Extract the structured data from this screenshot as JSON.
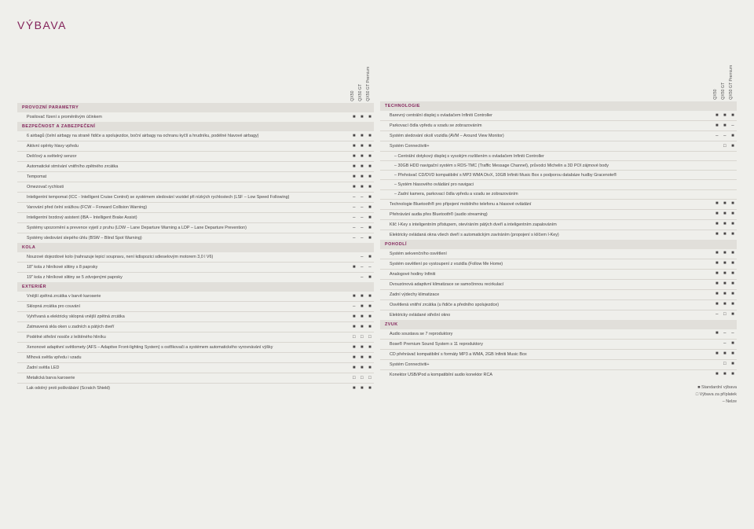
{
  "title": "VÝBAVA",
  "columnHeaders": [
    "QX50",
    "QX50 GT",
    "QX50 GT Premium"
  ],
  "legend": [
    "■ Standardní výbava",
    "□ Výbava za příplatek",
    "– Nelze"
  ],
  "symbols": {
    "f": "■",
    "o": "□",
    "n": "–",
    "b": ""
  },
  "left": [
    {
      "type": "section",
      "text": "PROVOZNÍ PARAMETRY"
    },
    {
      "type": "row",
      "text": "Posilovač řízení s proměnlivým účinkem",
      "v": [
        "f",
        "f",
        "f"
      ]
    },
    {
      "type": "section",
      "text": "BEZPEČNOST A ZABEZPEČENÍ"
    },
    {
      "type": "row",
      "text": "6 airbagů (čelní airbagy na straně řidiče a spolujezdce, boční airbagy na ochranu kyčlí a hrudníku, podélné hlavové airbagy)",
      "v": [
        "f",
        "f",
        "f"
      ]
    },
    {
      "type": "row",
      "text": "Aktivní opěrky hlavy vpředu",
      "v": [
        "f",
        "f",
        "f"
      ]
    },
    {
      "type": "row",
      "text": "Dešťový a světelný senzor",
      "v": [
        "f",
        "f",
        "f"
      ]
    },
    {
      "type": "row",
      "text": "Automatické stmívání vnitřního zpětného zrcátka",
      "v": [
        "f",
        "f",
        "f"
      ]
    },
    {
      "type": "row",
      "text": "Tempomat",
      "v": [
        "f",
        "f",
        "f"
      ]
    },
    {
      "type": "row",
      "text": "Omezovač rychlosti",
      "v": [
        "f",
        "f",
        "f"
      ]
    },
    {
      "type": "row",
      "text": "Inteligentní tempomat (ICC - Intelligent Cruise Control) se systémem sledování vozidel při nízkých rychlostech (LSF – Low Speed Following)",
      "v": [
        "n",
        "n",
        "f"
      ]
    },
    {
      "type": "row",
      "text": "Varování před čelní srážkou (FCW – Forward Collision Warning)",
      "v": [
        "n",
        "n",
        "f"
      ]
    },
    {
      "type": "row",
      "text": "Inteligentní brzdový asistent (IBA – Intelligent Brake Assist)",
      "v": [
        "n",
        "n",
        "f"
      ]
    },
    {
      "type": "row",
      "text": "Systémy upozornění a prevence vyjetí z pruhu (LDW – Lane Departure Warning a LDP – Lane Departure Prevention)",
      "v": [
        "n",
        "n",
        "f"
      ]
    },
    {
      "type": "row",
      "text": "Systémy sledování slepého úhlu (BSW – Blind Spot Warning)",
      "v": [
        "n",
        "n",
        "f"
      ]
    },
    {
      "type": "section",
      "text": "KOLA"
    },
    {
      "type": "row",
      "text": "Nouzové dojezdové kolo (nahrazuje lepicí soupravu, není kdispozici sdieselovým motorem 3,0 l V6)",
      "v": [
        "b",
        "n",
        "f"
      ]
    },
    {
      "type": "row",
      "text": "18\" kola z hliníkové slitiny s 8 paprsky",
      "v": [
        "f",
        "n",
        "n"
      ]
    },
    {
      "type": "row",
      "text": "19\" kola z hliníkové slitiny se 5 zdvojenými paprsky",
      "v": [
        "b",
        "n",
        "f"
      ]
    },
    {
      "type": "section",
      "text": "EXTERIÉR"
    },
    {
      "type": "row",
      "text": "Vnější zpětná zrcátka v barvě karoserie",
      "v": [
        "f",
        "f",
        "f"
      ]
    },
    {
      "type": "row",
      "text": "Sklopná zrcátka pro couvání",
      "v": [
        "n",
        "f",
        "f"
      ]
    },
    {
      "type": "row",
      "text": "Vyhřívaná a elektricky sklopná vnější zpětná zrcátka",
      "v": [
        "f",
        "f",
        "f"
      ]
    },
    {
      "type": "row",
      "text": "Zatmavená skla oken u zadních a pátých dveří",
      "v": [
        "f",
        "f",
        "f"
      ]
    },
    {
      "type": "row",
      "text": "Podélné střešní nosiče z leštěného hliníku",
      "v": [
        "o",
        "o",
        "o"
      ]
    },
    {
      "type": "row",
      "text": "Xenonové adaptivní světlomety (AFS – Adaptive Front-lighting System) s ostřikovači a systémem automatického vyrovnávání výšky",
      "v": [
        "f",
        "f",
        "f"
      ]
    },
    {
      "type": "row",
      "text": "Mlhová světla vpředu i vzadu",
      "v": [
        "f",
        "f",
        "f"
      ]
    },
    {
      "type": "row",
      "text": "Zadní světla LED",
      "v": [
        "f",
        "f",
        "f"
      ]
    },
    {
      "type": "row",
      "text": "Metalická barva karoserie",
      "v": [
        "o",
        "o",
        "o"
      ]
    },
    {
      "type": "row",
      "text": "Lak odolný proti poškrábání (Scratch Shield)",
      "v": [
        "f",
        "f",
        "f"
      ]
    }
  ],
  "right": [
    {
      "type": "section",
      "text": "TECHNOLOGIE"
    },
    {
      "type": "row",
      "text": "Barevný centrální displej s ovladačem Infiniti Controller",
      "v": [
        "f",
        "f",
        "f"
      ]
    },
    {
      "type": "row",
      "text": "Parkovací čidla vpředu a vzadu se zobrazováním",
      "v": [
        "f",
        "f",
        "n"
      ]
    },
    {
      "type": "row",
      "text": "Systém sledování okolí vozidla (AVM – Around View Monitor)",
      "v": [
        "n",
        "n",
        "f"
      ]
    },
    {
      "type": "row",
      "text": "Systém Connectiviti+",
      "v": [
        "b",
        "o",
        "f"
      ]
    },
    {
      "type": "sub",
      "text": "Centrální dotykový displej s vysokým rozlišením s ovladačem Infiniti Controller",
      "v": [
        "b",
        "b",
        "b"
      ]
    },
    {
      "type": "sub",
      "text": "30GB HDD navigační systém s RDS-TMC (Traffic Message Channel), průvodci Michelin a 3D POI zájmové body",
      "v": [
        "b",
        "b",
        "b"
      ]
    },
    {
      "type": "sub",
      "text": "Přehrávač CD/DVD kompatibilní s MP3 WMA DivX, 10GB Infiniti Music Box s podporou databáze hudby Gracenote®",
      "v": [
        "b",
        "b",
        "b"
      ]
    },
    {
      "type": "sub",
      "text": "Systém hlasového ovládání pro navigaci",
      "v": [
        "b",
        "b",
        "b"
      ]
    },
    {
      "type": "sub",
      "text": "Zadní kamera, parkovací čidla vpředu a vzadu se zobrazováním",
      "v": [
        "b",
        "b",
        "b"
      ]
    },
    {
      "type": "row",
      "text": "Technologie Bluetooth® pro připojení mobilního telefonu a hlasové ovládání",
      "v": [
        "f",
        "f",
        "f"
      ]
    },
    {
      "type": "row",
      "text": "Přehrávání audia přes Bluetooth® (audio streaming)",
      "v": [
        "f",
        "f",
        "f"
      ]
    },
    {
      "type": "row",
      "text": "Klíč I-Key s inteligentním přístupem, otevíráním pátých dveří a inteligentním zapalováním",
      "v": [
        "f",
        "f",
        "f"
      ]
    },
    {
      "type": "row",
      "text": "Elektricky ovládaná okna všech dveří s automatickým zavíráním (propojení s klíčem I-Key)",
      "v": [
        "f",
        "f",
        "f"
      ]
    },
    {
      "type": "section",
      "text": "POHODLÍ"
    },
    {
      "type": "row",
      "text": "Systém sekvenčního osvětlení",
      "v": [
        "f",
        "f",
        "f"
      ]
    },
    {
      "type": "row",
      "text": "Systém osvětlení po vystoupení z vozidla (Follow Me Home)",
      "v": [
        "f",
        "f",
        "f"
      ]
    },
    {
      "type": "row",
      "text": "Analogové hodiny Infiniti",
      "v": [
        "f",
        "f",
        "f"
      ]
    },
    {
      "type": "row",
      "text": "Dvouzónová adaptivní klimatizace se samočinnou recirkulací",
      "v": [
        "f",
        "f",
        "f"
      ]
    },
    {
      "type": "row",
      "text": "Zadní výdechy klimatizace",
      "v": [
        "f",
        "f",
        "f"
      ]
    },
    {
      "type": "row",
      "text": "Osvětlená vnitřní zrcátka (u řidiče a předního spolujezdce)",
      "v": [
        "f",
        "f",
        "f"
      ]
    },
    {
      "type": "row",
      "text": "Elektricky ovládané střešní okno",
      "v": [
        "n",
        "o",
        "f"
      ]
    },
    {
      "type": "section",
      "text": "ZVUK"
    },
    {
      "type": "row",
      "text": "Audio soustava se 7 reproduktory",
      "v": [
        "f",
        "n",
        "n"
      ]
    },
    {
      "type": "row",
      "text": "Bose® Premium Sound System s 11 reproduktory",
      "v": [
        "b",
        "n",
        "f"
      ]
    },
    {
      "type": "row",
      "text": "CD přehrávač kompatibilní s formáty MP3 a WMA, 2GB Infiniti Music Box",
      "v": [
        "f",
        "f",
        "f"
      ]
    },
    {
      "type": "row",
      "text": "Systém Connectiviti+",
      "v": [
        "b",
        "o",
        "f"
      ]
    },
    {
      "type": "row",
      "text": "Konektor USB/iPod a kompatibilní audio konektor RCA",
      "v": [
        "f",
        "f",
        "f"
      ]
    }
  ]
}
